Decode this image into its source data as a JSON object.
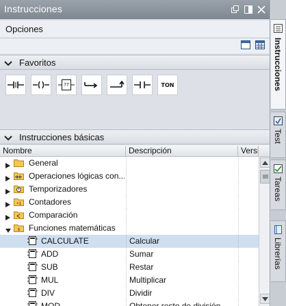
{
  "window": {
    "title": "Instrucciones",
    "controls": [
      "float-icon",
      "split-icon",
      "close-icon"
    ]
  },
  "options": {
    "label": "Opciones",
    "tools": [
      "single-pane-icon",
      "table-view-icon"
    ]
  },
  "favorites": {
    "label": "Favoritos",
    "items": [
      {
        "name": "normally-open-contact-icon"
      },
      {
        "name": "output-coil-icon"
      },
      {
        "name": "empty-box-icon",
        "text": "??"
      },
      {
        "name": "open-branch-icon"
      },
      {
        "name": "close-branch-icon"
      },
      {
        "name": "negated-contact-icon"
      },
      {
        "name": "ton-timer-icon",
        "text": "TON"
      }
    ]
  },
  "basic": {
    "label": "Instrucciones básicas",
    "columns": {
      "name": "Nombre",
      "description": "Descripción",
      "version": "Versi"
    },
    "rows": [
      {
        "label": "General",
        "description": "",
        "icon": "folder-icon",
        "expandable": true,
        "expanded": false,
        "level": 0
      },
      {
        "label": "Operaciones lógicas con...",
        "description": "",
        "icon": "bit-logic-folder-icon",
        "expandable": true,
        "expanded": false,
        "level": 0
      },
      {
        "label": "Temporizadores",
        "description": "",
        "icon": "timer-folder-icon",
        "expandable": true,
        "expanded": false,
        "level": 0
      },
      {
        "label": "Contadores",
        "description": "",
        "icon": "counter-folder-icon",
        "expandable": true,
        "expanded": false,
        "level": 0
      },
      {
        "label": "Comparación",
        "description": "",
        "icon": "compare-folder-icon",
        "expandable": true,
        "expanded": false,
        "level": 0
      },
      {
        "label": "Funciones matemáticas",
        "description": "",
        "icon": "math-folder-icon",
        "expandable": true,
        "expanded": true,
        "level": 0
      },
      {
        "label": "CALCULATE",
        "description": "Calcular",
        "icon": "instruction-block-icon",
        "expandable": false,
        "level": 1,
        "selected": true
      },
      {
        "label": "ADD",
        "description": "Sumar",
        "icon": "instruction-block-icon",
        "expandable": false,
        "level": 1
      },
      {
        "label": "SUB",
        "description": "Restar",
        "icon": "instruction-block-icon",
        "expandable": false,
        "level": 1
      },
      {
        "label": "MUL",
        "description": "Multiplicar",
        "icon": "instruction-block-icon",
        "expandable": false,
        "level": 1
      },
      {
        "label": "DIV",
        "description": "Dividir",
        "icon": "instruction-block-icon",
        "expandable": false,
        "level": 1
      },
      {
        "label": "MOD",
        "description": "Obtener resto de división",
        "icon": "instruction-block-icon",
        "expandable": false,
        "level": 1
      }
    ]
  },
  "sidetabs": [
    {
      "label": "Instrucciones",
      "icon": "instructions-tab-icon",
      "active": true
    },
    {
      "label": "Test",
      "icon": "test-tab-icon",
      "active": false
    },
    {
      "label": "Tareas",
      "icon": "tasks-tab-icon",
      "active": false
    },
    {
      "label": "Librerías",
      "icon": "libraries-tab-icon",
      "active": false
    }
  ],
  "colors": {
    "titlebar": "#8a929b",
    "selection": "#cfdff0",
    "folder": "#f2c34a"
  }
}
